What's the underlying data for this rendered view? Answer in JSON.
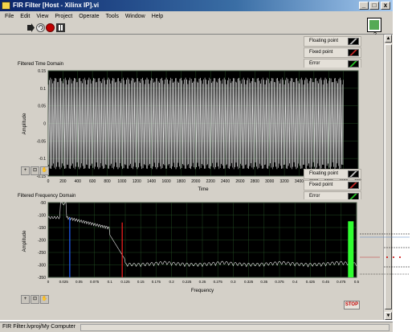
{
  "window": {
    "title": "FIR Filter [Host - Xilinx IP].vi",
    "minimize": "_",
    "maximize": "□",
    "close": "x"
  },
  "menu": {
    "items": [
      "File",
      "Edit",
      "View",
      "Project",
      "Operate",
      "Tools",
      "Window",
      "Help"
    ]
  },
  "time_graph": {
    "label": "Filtered Time Domain",
    "legend": [
      {
        "label": "Floating point",
        "color": "#ffffff"
      },
      {
        "label": "Fixed point",
        "color": "#ff3030"
      },
      {
        "label": "Error",
        "color": "#30ff30"
      }
    ]
  },
  "freq_graph": {
    "label": "Filtered Frequency Domain",
    "legend": [
      {
        "label": "Floating point",
        "color": "#ffffff"
      },
      {
        "label": "Fixed point",
        "color": "#ff3030"
      },
      {
        "label": "Error",
        "color": "#30ff30"
      }
    ]
  },
  "palette": {
    "cursor": "+",
    "zoom": "⊡",
    "pan": "✋"
  },
  "stop_label": "STOP",
  "help_label": "?",
  "status": {
    "path": "FIR Filter.lvproj/My Computer"
  },
  "chart_data": [
    {
      "type": "line",
      "title": "Filtered Time Domain",
      "xlabel": "Time",
      "ylabel": "Amplitude",
      "xlim": [
        0,
        4200
      ],
      "ylim": [
        -0.15,
        0.15
      ],
      "x_ticks": [
        0,
        200,
        400,
        600,
        800,
        1000,
        1200,
        1400,
        1600,
        1800,
        2000,
        2200,
        2400,
        2600,
        2800,
        3000,
        3200,
        3400,
        3600,
        3800,
        4000,
        4200
      ],
      "y_ticks": [
        "0.15",
        "0.1",
        "0.05",
        "0",
        "-0.05",
        "-0.1",
        "-0.15"
      ],
      "grid": true,
      "series": [
        {
          "name": "Floating point",
          "x_range": [
            0,
            4000
          ],
          "amplitude": 0.13
        }
      ]
    },
    {
      "type": "line",
      "title": "Filtered Frequency Domain",
      "xlabel": "Frequency",
      "ylabel": "Amplitude",
      "xlim": [
        0,
        0.5
      ],
      "ylim": [
        -350,
        -50
      ],
      "x_ticks": [
        "0",
        "0.025",
        "0.05",
        "0.075",
        "0.1",
        "0.125",
        "0.15",
        "0.175",
        "0.2",
        "0.225",
        "0.25",
        "0.275",
        "0.3",
        "0.325",
        "0.35",
        "0.375",
        "0.4",
        "0.425",
        "0.45",
        "0.475",
        "0.5"
      ],
      "y_ticks": [
        "-50",
        "-100",
        "-150",
        "-200",
        "-250",
        "-300",
        "-350"
      ],
      "grid": true,
      "series": [
        {
          "name": "Floating point",
          "peak": {
            "x": 0.025,
            "y": -60
          },
          "passband": -110,
          "stopband": -300
        }
      ],
      "markers": [
        {
          "x": 0.035,
          "color": "#2060ff"
        },
        {
          "x": 0.12,
          "color": "#ff2020"
        },
        {
          "x": 0.49,
          "color": "#30ff30"
        }
      ]
    }
  ]
}
